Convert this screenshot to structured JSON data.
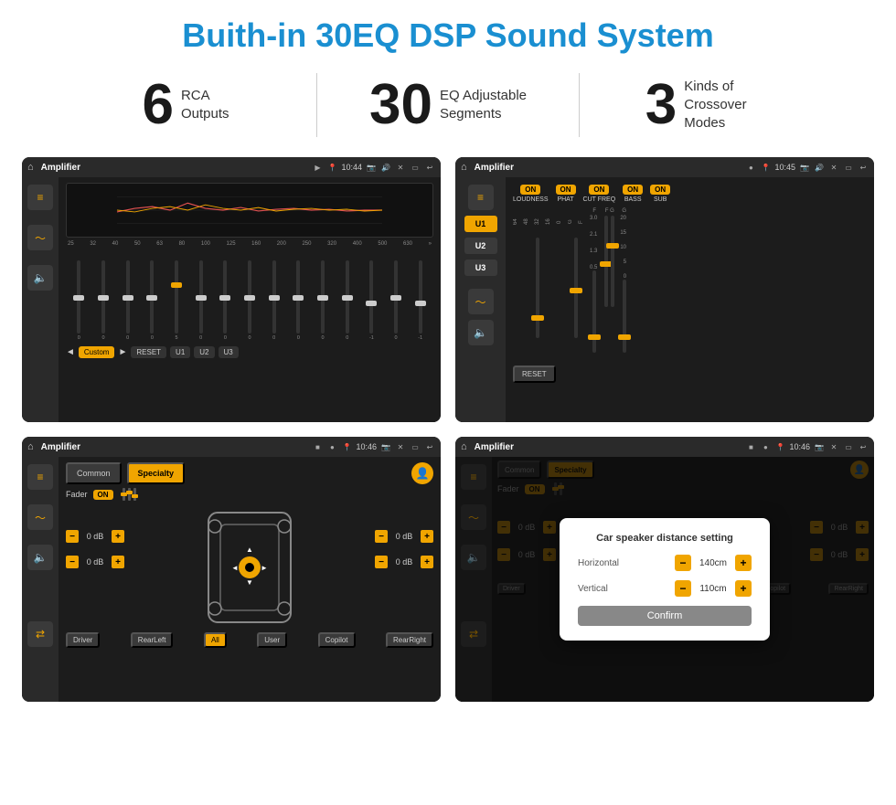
{
  "page": {
    "title": "Buith-in 30EQ DSP Sound System"
  },
  "stats": [
    {
      "number": "6",
      "label": "RCA\nOutputs"
    },
    {
      "number": "30",
      "label": "EQ Adjustable\nSegments"
    },
    {
      "number": "3",
      "label": "Kinds of\nCrossover Modes"
    }
  ],
  "screens": [
    {
      "id": "screen1",
      "title": "Amplifier",
      "time": "10:44",
      "type": "eq"
    },
    {
      "id": "screen2",
      "title": "Amplifier",
      "time": "10:45",
      "type": "amp"
    },
    {
      "id": "screen3",
      "title": "Amplifier",
      "time": "10:46",
      "type": "fader"
    },
    {
      "id": "screen4",
      "title": "Amplifier",
      "time": "10:46",
      "type": "dialog"
    }
  ],
  "eq": {
    "frequencies": [
      "25",
      "32",
      "40",
      "50",
      "63",
      "80",
      "100",
      "125",
      "160",
      "200",
      "250",
      "320",
      "400",
      "500",
      "630"
    ],
    "values": [
      "0",
      "0",
      "0",
      "0",
      "5",
      "0",
      "0",
      "0",
      "0",
      "0",
      "0",
      "0",
      "-1",
      "0",
      "-1"
    ],
    "preset": "Custom",
    "buttons": [
      "RESET",
      "U1",
      "U2",
      "U3"
    ]
  },
  "amp": {
    "sections": [
      "U1",
      "U2",
      "U3"
    ],
    "toggles": [
      "LOUDNESS",
      "PHAT",
      "CUT FREQ",
      "BASS",
      "SUB"
    ],
    "reset": "RESET"
  },
  "fader": {
    "tabs": [
      "Common",
      "Specialty"
    ],
    "fader_label": "Fader",
    "on_label": "ON",
    "db_values": [
      "0 dB",
      "0 dB",
      "0 dB",
      "0 dB"
    ],
    "nav_buttons": [
      "Driver",
      "RearLeft",
      "All",
      "User",
      "Copilot",
      "RearRight"
    ]
  },
  "dialog": {
    "title": "Car speaker distance setting",
    "horizontal_label": "Horizontal",
    "horizontal_value": "140cm",
    "vertical_label": "Vertical",
    "vertical_value": "110cm",
    "confirm_label": "Confirm"
  }
}
